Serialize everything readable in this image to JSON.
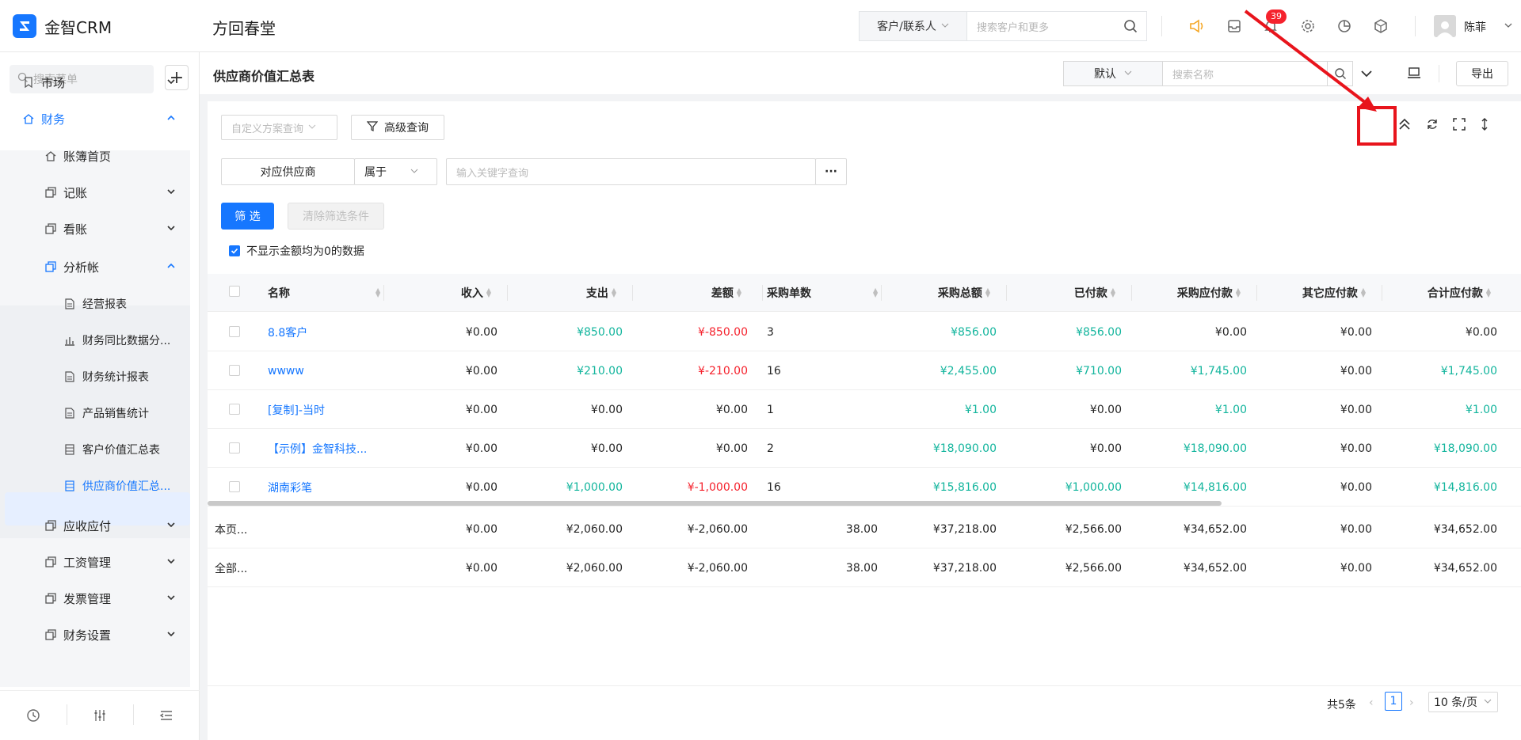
{
  "app": {
    "logo_text": "金智CRM",
    "company": "方回春堂"
  },
  "global_search": {
    "scope": "客户/联系人",
    "placeholder": "搜索客户和更多"
  },
  "notifications": {
    "count": "39"
  },
  "user": {
    "name": "陈菲"
  },
  "sidebar": {
    "search_placeholder": "搜索菜单",
    "items": [
      {
        "label": "市场",
        "level": 1,
        "icon": "bookmark-icon",
        "chevron": "down"
      },
      {
        "label": "财务",
        "level": 1,
        "icon": "home-icon",
        "chevron": "up",
        "active": true
      },
      {
        "label": "账簿首页",
        "level": 2,
        "icon": "home-icon"
      },
      {
        "label": "记账",
        "level": 2,
        "icon": "copy-icon",
        "chevron": "down"
      },
      {
        "label": "看账",
        "level": 2,
        "icon": "copy-icon",
        "chevron": "down"
      },
      {
        "label": "分析帐",
        "level": 2,
        "icon": "copy-icon",
        "chevron": "up",
        "active": true
      },
      {
        "label": "经营报表",
        "level": 3,
        "icon": "document-icon"
      },
      {
        "label": "财务同比数据分...",
        "level": 3,
        "icon": "bar-chart-icon"
      },
      {
        "label": "财务统计报表",
        "level": 3,
        "icon": "document-icon"
      },
      {
        "label": "产品销售统计",
        "level": 3,
        "icon": "document-icon"
      },
      {
        "label": "客户价值汇总表",
        "level": 3,
        "icon": "table-icon"
      },
      {
        "label": "供应商价值汇总...",
        "level": 3,
        "icon": "table-icon",
        "selected": true
      },
      {
        "label": "应收应付",
        "level": 2,
        "icon": "copy-icon",
        "chevron": "down"
      },
      {
        "label": "工资管理",
        "level": 2,
        "icon": "copy-icon",
        "chevron": "down"
      },
      {
        "label": "发票管理",
        "level": 2,
        "icon": "copy-icon",
        "chevron": "down"
      },
      {
        "label": "财务设置",
        "level": 2,
        "icon": "copy-icon",
        "chevron": "down"
      }
    ]
  },
  "page": {
    "title": "供应商价值汇总表",
    "view_select": "默认",
    "search_placeholder": "搜索名称",
    "export_label": "导出"
  },
  "filters": {
    "scheme_placeholder": "自定义方案查询",
    "advanced_label": "高级查询",
    "field": "对应供应商",
    "operator": "属于",
    "keyword_placeholder": "输入关键字查询",
    "more": "···",
    "filter_label": "筛 选",
    "clear_label": "清除筛选条件",
    "hide_zero_label": "不显示金额均为0的数据",
    "hide_zero_checked": true
  },
  "table": {
    "columns": [
      "名称",
      "收入",
      "支出",
      "差额",
      "采购单数",
      "采购总额",
      "已付款",
      "采购应付款",
      "其它应付款",
      "合计应付款"
    ],
    "rows": [
      {
        "name": "8.8客户",
        "income": "¥0.00",
        "expense": "¥850.00",
        "diff": "¥-850.00",
        "orders": "3",
        "total": "¥856.00",
        "paid": "¥856.00",
        "payable": "¥0.00",
        "other": "¥0.00",
        "sum": "¥0.00"
      },
      {
        "name": "wwww",
        "income": "¥0.00",
        "expense": "¥210.00",
        "diff": "¥-210.00",
        "orders": "16",
        "total": "¥2,455.00",
        "paid": "¥710.00",
        "payable": "¥1,745.00",
        "other": "¥0.00",
        "sum": "¥1,745.00"
      },
      {
        "name": "[复制]-当时",
        "income": "¥0.00",
        "expense": "¥0.00",
        "diff": "¥0.00",
        "orders": "1",
        "total": "¥1.00",
        "paid": "¥0.00",
        "payable": "¥1.00",
        "other": "¥0.00",
        "sum": "¥1.00"
      },
      {
        "name": "【示例】金智科技...",
        "income": "¥0.00",
        "expense": "¥0.00",
        "diff": "¥0.00",
        "orders": "2",
        "total": "¥18,090.00",
        "paid": "¥0.00",
        "payable": "¥18,090.00",
        "other": "¥0.00",
        "sum": "¥18,090.00"
      },
      {
        "name": "湖南彩笔",
        "income": "¥0.00",
        "expense": "¥1,000.00",
        "diff": "¥-1,000.00",
        "orders": "16",
        "total": "¥15,816.00",
        "paid": "¥1,000.00",
        "payable": "¥14,816.00",
        "other": "¥0.00",
        "sum": "¥14,816.00"
      }
    ],
    "summary": [
      {
        "label": "本页...",
        "income": "¥0.00",
        "expense": "¥2,060.00",
        "diff": "¥-2,060.00",
        "orders": "38.00",
        "total": "¥37,218.00",
        "paid": "¥2,566.00",
        "payable": "¥34,652.00",
        "other": "¥0.00",
        "sum": "¥34,652.00"
      },
      {
        "label": "全部...",
        "income": "¥0.00",
        "expense": "¥2,060.00",
        "diff": "¥-2,060.00",
        "orders": "38.00",
        "total": "¥37,218.00",
        "paid": "¥2,566.00",
        "payable": "¥34,652.00",
        "other": "¥0.00",
        "sum": "¥34,652.00"
      }
    ]
  },
  "pagination": {
    "total": "共5条",
    "current": "1",
    "page_size": "10 条/页"
  },
  "colors": {
    "accent": "#1677ff",
    "positive": "#13b59d",
    "negative": "#f5222d",
    "annotation": "#e8141c"
  }
}
